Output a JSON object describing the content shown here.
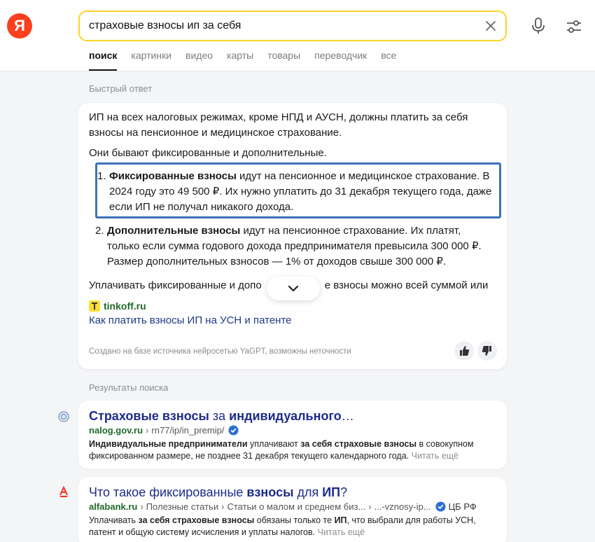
{
  "logo": "Я",
  "search": {
    "query": "страховые взносы ип за себя"
  },
  "tabs": [
    "поиск",
    "картинки",
    "видео",
    "карты",
    "товары",
    "переводчик",
    "все"
  ],
  "quick_answer": {
    "label": "Быстрый ответ",
    "lead": "ИП на всех налоговых режимах, кроме НПД и АУСН, должны платить за себя взносы на пенсионное и медицинское страхование.",
    "sub": "Они бывают фиксированные и дополнительные.",
    "items": [
      {
        "num": "1.",
        "bold": "Фиксированные взносы",
        "text": " идут на пенсионное и медицинское страхование. В 2024 году это 49 500 ₽. Их нужно уплатить до 31 декабря текущего года, даже если ИП не получал никакого дохода."
      },
      {
        "num": "2.",
        "bold": "Дополнительные взносы",
        "text": " идут на пенсионное страхование. Их платят, только если сумма годового дохода предпринимателя превысила 300 000 ₽. Размер дополнительных взносов — 1% от доходов свыше 300 000 ₽."
      }
    ],
    "cut_text": "Уплачивать фиксированные и допо",
    "cut_text_tail": "е взносы можно всей суммой или",
    "source_name": "tinkoff.ru",
    "source_link": "Как платить взносы ИП на УСН и патенте",
    "disclaimer": "Создано на базе источника нейросетью YaGPT, возможны неточности"
  },
  "results_label": "Результаты поиска",
  "results": [
    {
      "title_parts": [
        "Страховые взносы",
        " за ",
        "индивидуального",
        "…"
      ],
      "host": "nalog.gov.ru",
      "path": [
        "rn77/ip/in_premip/"
      ],
      "verified": true,
      "badge": "",
      "desc_parts": [
        "Индивидуальные предприниматели",
        " уплачивают ",
        "за себя страховые взносы",
        " в совокупном фиксированном размере, не позднее 31 декабря текущего календарного года. "
      ],
      "readmore": "Читать ещё"
    },
    {
      "title_parts": [
        "Что такое фиксированные ",
        "взносы",
        " для ",
        "ИП",
        "?"
      ],
      "host": "alfabank.ru",
      "path": [
        "Полезные статьи",
        "Статьи о малом и среднем биз...",
        "...-vznosy-ip..."
      ],
      "verified": true,
      "badge": "ЦБ РФ",
      "desc_parts": [
        "Уплачивать ",
        "за себя страховые взносы",
        " обязаны только те ",
        "ИП",
        ", что выбрали для работы УСН, патент и общую систему исчисления и уплаты налогов. "
      ],
      "readmore": "Читать ещё"
    }
  ],
  "colors": {
    "accent_yellow": "#fed42b",
    "logo_red": "#fc3f1d",
    "link_blue": "#1d2b8a",
    "host_green": "#1f6b2a",
    "highlight_border": "#3b73b9"
  }
}
